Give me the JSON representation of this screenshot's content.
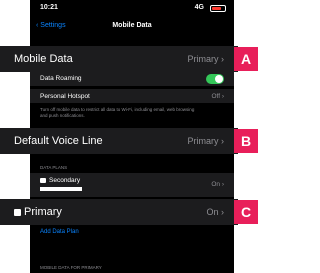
{
  "status": {
    "time": "10:21",
    "network": "4G"
  },
  "nav": {
    "back": "Settings",
    "title": "Mobile Data"
  },
  "callouts": {
    "mobile_data": {
      "label": "Mobile Data",
      "value": "Primary",
      "tag": "A"
    },
    "default_voice": {
      "label": "Default Voice Line",
      "value": "Primary",
      "tag": "B"
    },
    "primary": {
      "label": "Primary",
      "value": "On",
      "tag": "C"
    }
  },
  "rows": {
    "data_roaming": "Data Roaming",
    "personal_hotspot": {
      "label": "Personal Hotspot",
      "value": "Off"
    }
  },
  "note": "Turn off mobile data to restrict all data to Wi-Fi, including email, web browsing and push notifications.",
  "data_plans": {
    "header": "DATA PLANS",
    "secondary": {
      "label": "Secondary",
      "value": "On"
    },
    "add_plan": "Add Data Plan"
  },
  "footer_header": "MOBILE DATA FOR PRIMARY",
  "colors": {
    "accent": "#e81f5a",
    "link": "#0a84ff",
    "toggle_on": "#34c759"
  }
}
